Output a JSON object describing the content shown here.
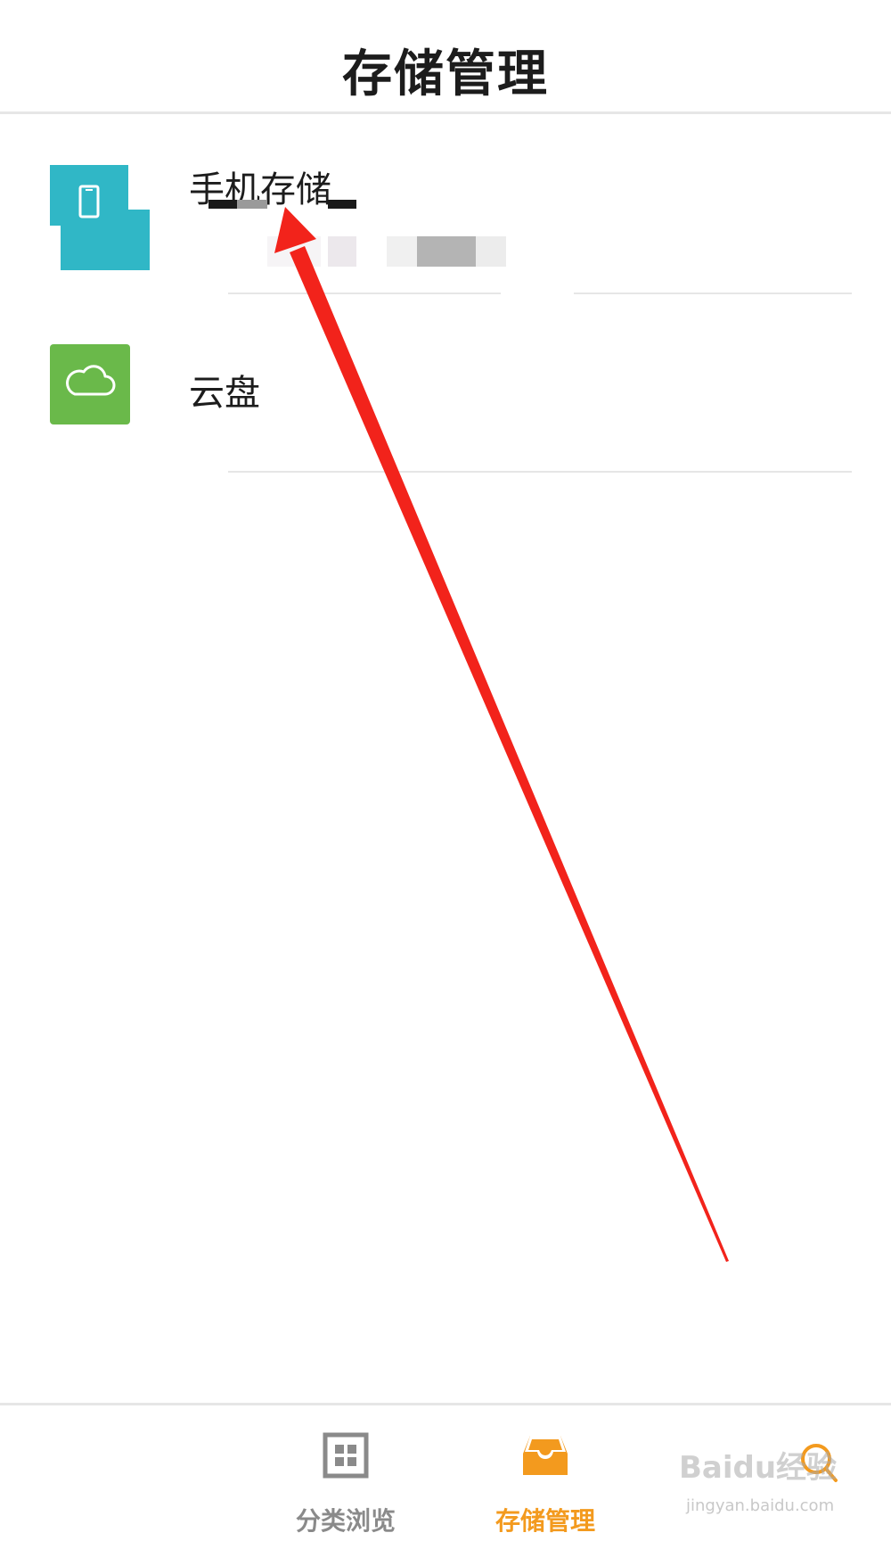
{
  "header": {
    "title": "存储管理"
  },
  "storage_list": [
    {
      "label": "手机存储",
      "icon": "phone-icon",
      "color": "#30b7c6"
    },
    {
      "label": "云盘",
      "icon": "cloud-icon",
      "color": "#6ab94a"
    }
  ],
  "tab_bar": {
    "tabs": [
      {
        "label": "分类浏览",
        "icon": "grid-icon",
        "active": false
      },
      {
        "label": "存储管理",
        "icon": "inbox-icon",
        "active": true
      },
      {
        "label": "",
        "icon": "search-icon",
        "active": false
      }
    ],
    "active_color": "#f39a1e",
    "inactive_color": "#8a8a8a"
  },
  "watermark": {
    "text": "Baidu经验",
    "url": "jingyan.baidu.com"
  },
  "annotation": {
    "arrow_color": "#f2231b"
  }
}
